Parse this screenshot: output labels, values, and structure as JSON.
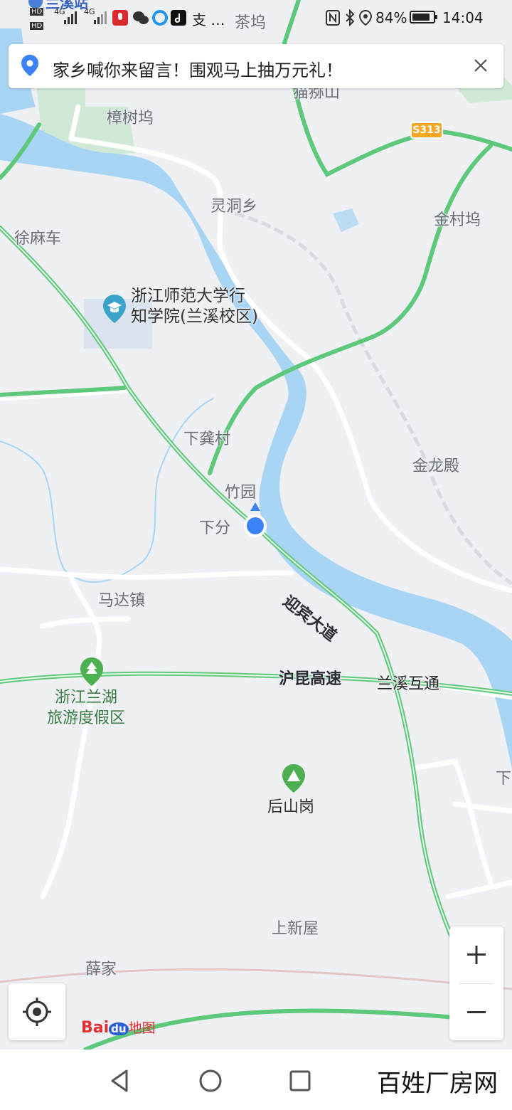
{
  "status_bar": {
    "nearby_station": "兰溪站",
    "network_1": "4G",
    "network_2": "4G",
    "carrier_extra": "支 …",
    "place_top": "茶坞",
    "battery": "84%",
    "battery_level": 0.84,
    "time": "14:04"
  },
  "banner": {
    "text": "家乡喊你来留言！围观马上抽万元礼！"
  },
  "map": {
    "labels": {
      "top_hidden": "猫猕山",
      "zhangshuwu": "樟树坞",
      "road_shield": "S313",
      "lingdong": "灵洞乡",
      "jincunwu": "金村坞",
      "xumache": "徐麻车",
      "poi_school": "浙江师范大学行\n知学院(兰溪校区)",
      "xiagongcun": "下龚村",
      "zhuyuan": "竹园",
      "xiafen": "下分",
      "jinlongdian": "金龙殿",
      "yingbin": "迎宾大道",
      "madazhen": "马达镇",
      "hukun": "沪昆高速",
      "lanxi_hutong": "兰溪互通",
      "poi_lanhu": "浙江兰湖\n旅游度假区",
      "houshangang": "后山岗",
      "shangxinwu": "上新屋",
      "xuejia": "薛家",
      "right_edge": "下"
    }
  },
  "controls": {
    "zoom_in": "+",
    "zoom_out": "−",
    "logo_bai": "Bai",
    "logo_du": "du",
    "logo_ditu": "地图"
  },
  "watermark": "百姓厂房网",
  "colors": {
    "map_bg": "#eef0f4",
    "river": "#a9d5f5",
    "green_road": "#5ec97a",
    "white_road": "#ffffff",
    "green_area": "#cfe9d6",
    "location_dot": "#3b82f6"
  }
}
